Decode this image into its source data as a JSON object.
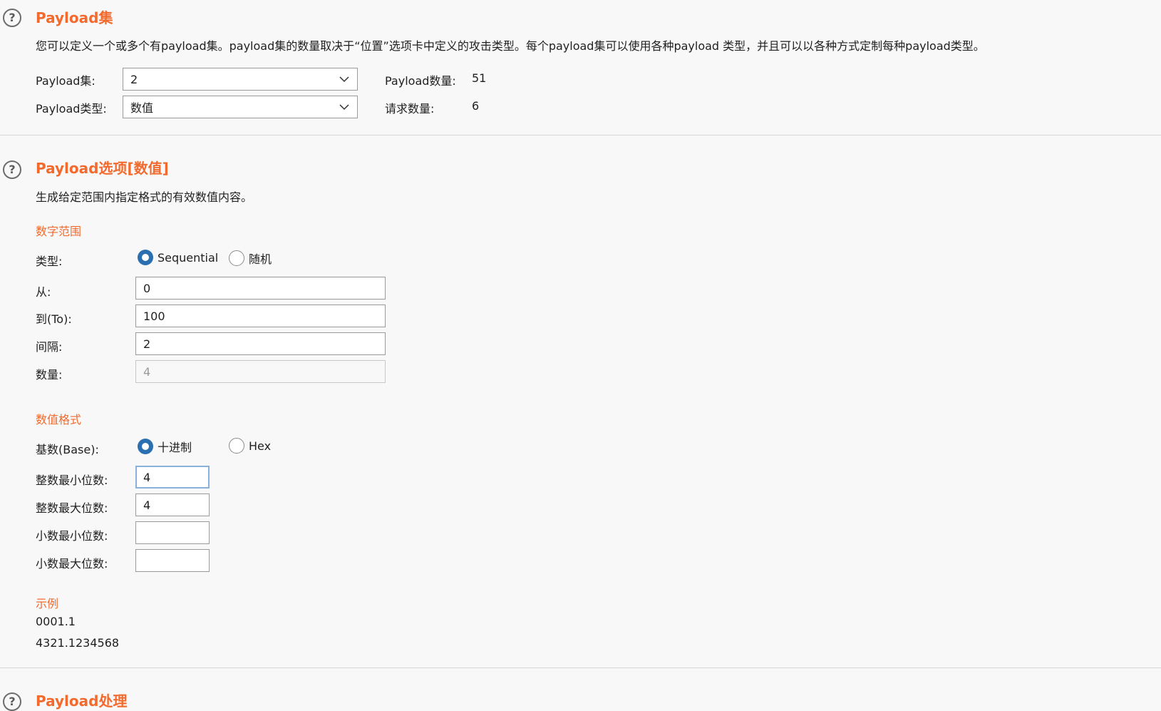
{
  "payload_sets": {
    "title": "Payload集",
    "description": "您可以定义一个或多个有payload集。payload集的数量取决于“位置”选项卡中定义的攻击类型。每个payload集可以使用各种payload 类型，并且可以以各种方式定制每种payload类型。",
    "set_label": "Payload集:",
    "set_value": "2",
    "type_label": "Payload类型:",
    "type_value": "数值",
    "count_label": "Payload数量:",
    "count_value": "51",
    "request_label": "请求数量:",
    "request_value": "6"
  },
  "payload_options": {
    "title": "Payload选项[数值]",
    "description": "生成给定范围内指定格式的有效数值内容。",
    "number_range": {
      "heading": "数字范围",
      "type_label": "类型:",
      "type_options": [
        "Sequential",
        "随机"
      ],
      "type_selected": "Sequential",
      "from_label": "从:",
      "from_value": "0",
      "to_label": "到(To):",
      "to_value": "100",
      "step_label": "间隔:",
      "step_value": "2",
      "count_label": "数量:",
      "count_value": "4"
    },
    "number_format": {
      "heading": "数值格式",
      "base_label": "基数(Base):",
      "base_options": [
        "十进制",
        "Hex"
      ],
      "base_selected": "十进制",
      "min_int_label": "整数最小位数:",
      "min_int_value": "4",
      "max_int_label": "整数最大位数:",
      "max_int_value": "4",
      "min_frac_label": "小数最小位数:",
      "min_frac_value": "",
      "max_frac_label": "小数最大位数:",
      "max_frac_value": ""
    },
    "examples": {
      "heading": "示例",
      "items": [
        "0001.1",
        "4321.1234568"
      ]
    }
  },
  "payload_processing": {
    "title": "Payload处理"
  },
  "icons": {
    "help": "help-circle-icon",
    "dropdown": "chevron-down-icon",
    "help_glyph": "?"
  },
  "colors": {
    "accent": "#f26a2d",
    "radio_selected": "#2a6fb0",
    "background": "#f8f8f8"
  }
}
